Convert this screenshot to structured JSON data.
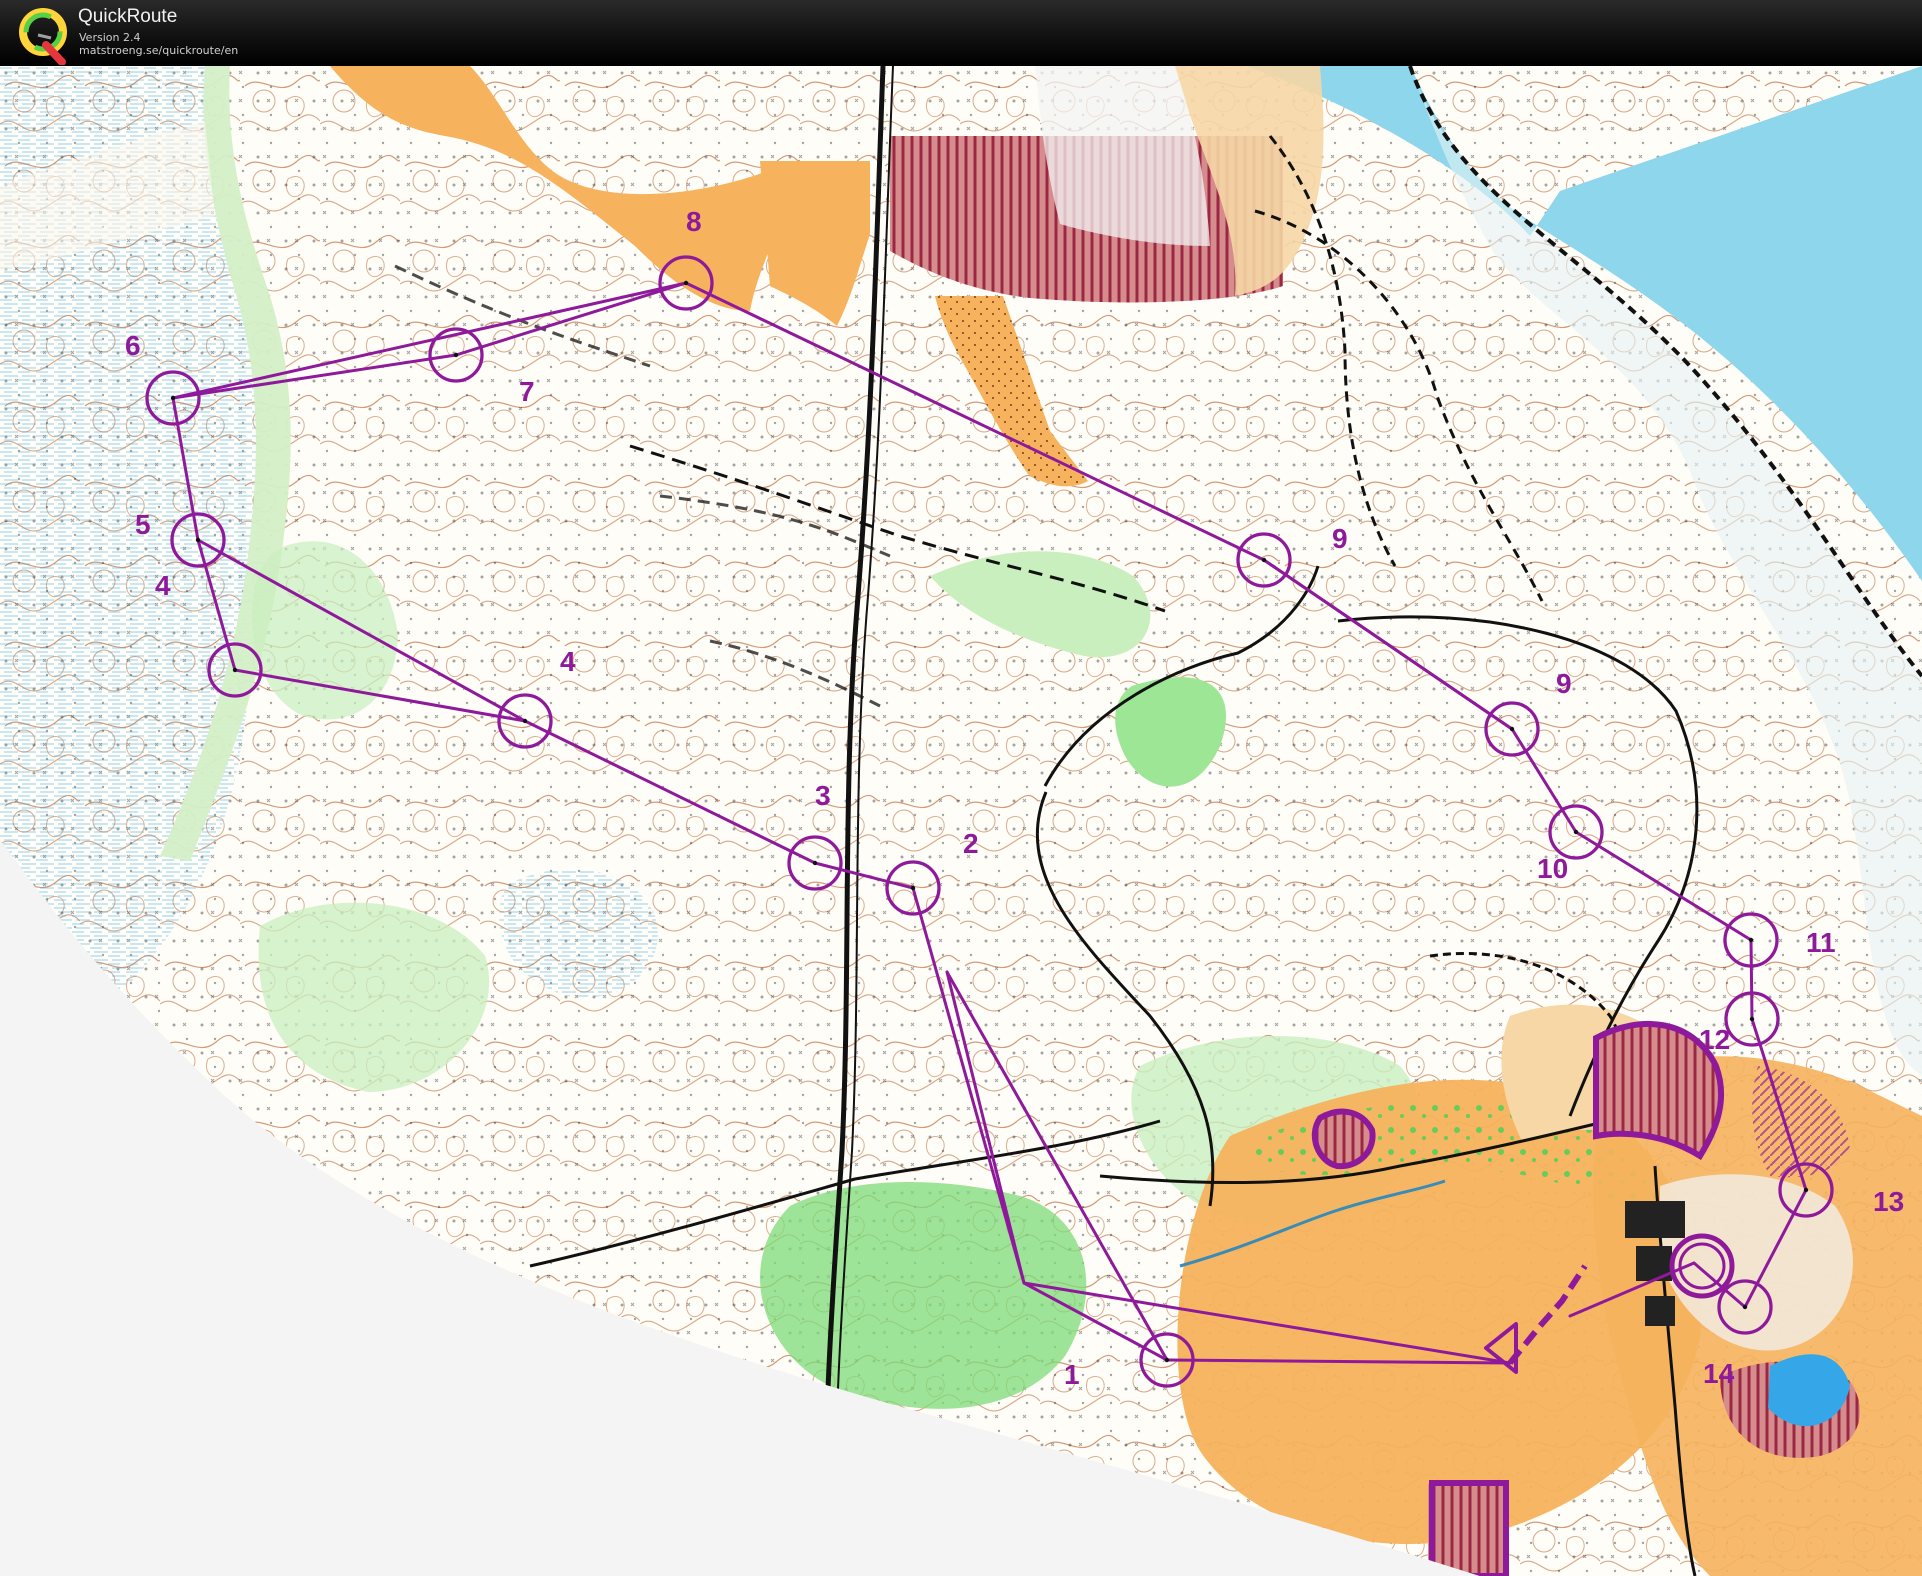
{
  "app": {
    "title": "QuickRoute",
    "version": "Version 2.4",
    "url": "matstroeng.se/quickroute/en",
    "logo_icon": "quickroute-q-logo-icon"
  },
  "colors": {
    "titlebar": "#111111",
    "paper": "#fffdf7",
    "open": "#f6b25c",
    "rough_open": "#f6d7a5",
    "forest_green": "#7ddb78",
    "light_green": "#c9efbf",
    "water": "#8dd6ec",
    "marsh": "#35a6e8",
    "course": "#8e1a9b",
    "contour": "#b7632e",
    "rock_black": "#111111",
    "restricted": "#c23b57"
  },
  "map": {
    "controls": [
      {
        "label": "1"
      },
      {
        "label": "2"
      },
      {
        "label": "3"
      },
      {
        "label": "4"
      },
      {
        "label": "4"
      },
      {
        "label": "5"
      },
      {
        "label": "6"
      },
      {
        "label": "7"
      },
      {
        "label": "8"
      },
      {
        "label": "9"
      },
      {
        "label": "9"
      },
      {
        "label": "10"
      },
      {
        "label": "11"
      },
      {
        "label": "12"
      },
      {
        "label": "13"
      },
      {
        "label": "14"
      }
    ]
  }
}
